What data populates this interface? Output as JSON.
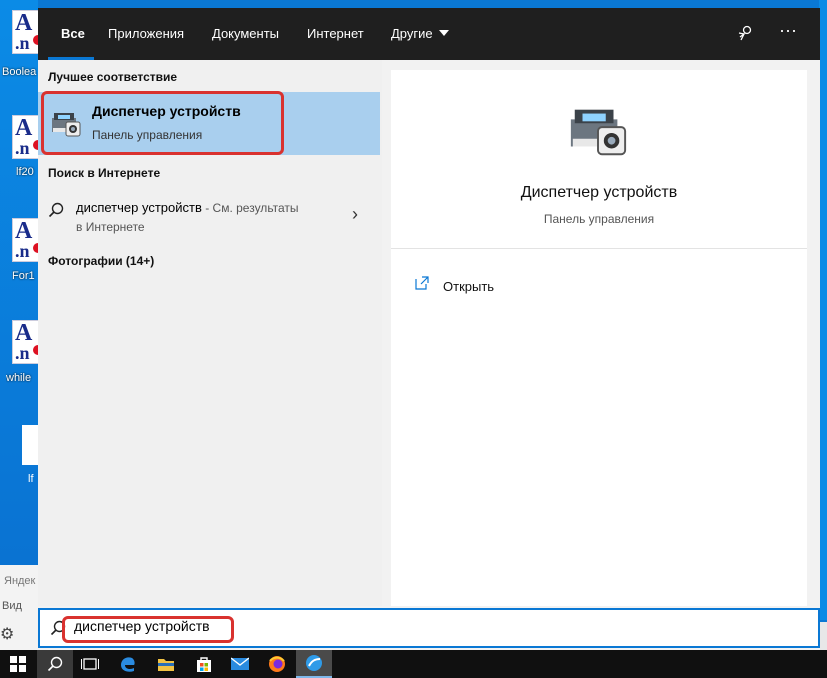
{
  "desktop": {
    "icons": [
      {
        "label": "Boolea"
      },
      {
        "label": "lf20"
      },
      {
        "label": "For1"
      },
      {
        "label": "while"
      }
    ],
    "blank_label": "lf",
    "sidepanel_line1": "Яндек",
    "sidepanel_line2": "Вид"
  },
  "tabs": {
    "all": "Все",
    "apps": "Приложения",
    "docs": "Документы",
    "internet": "Интернет",
    "other": "Другие"
  },
  "left_panel": {
    "best_match_header": "Лучшее соответствие",
    "best_match": {
      "name": "Диспетчер устройств",
      "subtitle": "Панель управления"
    },
    "web_header": "Поиск в Интернете",
    "web_result": {
      "query": "диспетчер устройств",
      "suffix": " - См. результаты",
      "suffix2": "в Интернете"
    },
    "photos_header": "Фотографии (14+)"
  },
  "right_panel": {
    "title": "Диспетчер устройств",
    "subtitle": "Панель управления",
    "action_open": "Открыть"
  },
  "search": {
    "query": "диспетчер устройств"
  },
  "taskbar": {
    "items": [
      "windows-start",
      "search",
      "task-view",
      "edge",
      "file-explorer",
      "store",
      "mail",
      "firefox",
      "app"
    ]
  },
  "colors": {
    "accent": "#0a78d4",
    "highlight": "#a9cfee",
    "annotation_red": "#d9322f"
  }
}
